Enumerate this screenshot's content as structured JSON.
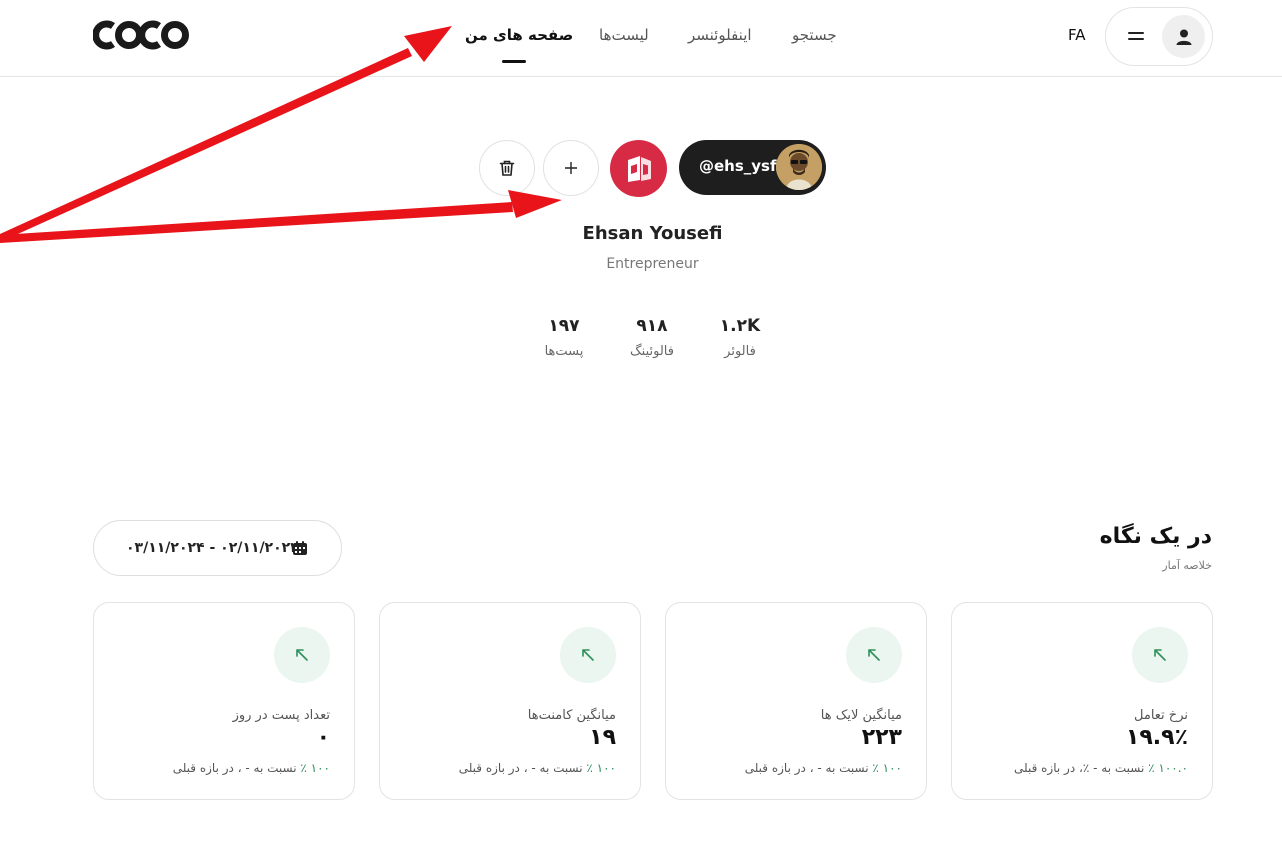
{
  "header": {
    "logo_text": "COCO",
    "nav": {
      "my_pages": "صفحه های من",
      "lists": "لیست‌ها",
      "influencer": "اینفلوئنسر",
      "search": "جستجو"
    },
    "lang": "FA"
  },
  "profile": {
    "handle": "@ehs_ysf",
    "name": "Ehsan Yousefi",
    "role": "Entrepreneur",
    "stats": {
      "posts": {
        "value": "۱۹۷",
        "label": "پست‌ها"
      },
      "following": {
        "value": "۹۱۸",
        "label": "فالوئینگ"
      },
      "followers": {
        "value": "۱.۲K",
        "label": "فالوئر"
      }
    }
  },
  "glance": {
    "title": "در یک نگاه",
    "subtitle": "خلاصه آمار",
    "date_range": "۰۳/۱۱/۲۰۲۴ - ۰۲/۱۱/۲۰۲۴",
    "cards": {
      "posts_per_day": {
        "label": "تعداد پست در روز",
        "value": "۰",
        "pct": "۱۰۰ ٪",
        "compare": " نسبت به - ، در بازه قبلی"
      },
      "avg_comments": {
        "label": "میانگین کامنت‌ها",
        "value": "۱۹",
        "pct": "۱۰۰ ٪",
        "compare": " نسبت به - ، در بازه قبلی"
      },
      "avg_likes": {
        "label": "میانگین لایک ها",
        "value": "۲۲۳",
        "pct": "۱۰۰ ٪",
        "compare": " نسبت به - ، در بازه قبلی"
      },
      "engagement": {
        "label": "نرخ تعامل",
        "value": "۱۹.۹٪",
        "pct": "۱۰۰.۰ ٪",
        "compare": " نسبت به - ٪، در بازه قبلی"
      }
    }
  },
  "colors": {
    "brand_red": "#d72a45",
    "positive_green": "#2f8f5b",
    "annotation_red": "#e8141a"
  }
}
